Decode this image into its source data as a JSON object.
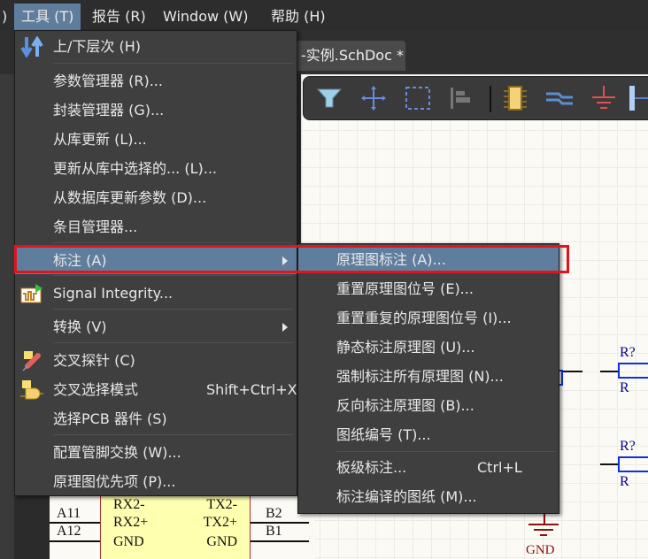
{
  "menubar": {
    "items": [
      {
        "label": ")"
      },
      {
        "label": "工具 (T)"
      },
      {
        "label": "报告 (R)"
      },
      {
        "label": "Window (W)"
      },
      {
        "label": "帮助 (H)"
      }
    ]
  },
  "document_tab": {
    "label": "-实例.SchDoc *"
  },
  "toolbar": {
    "icons": [
      "filter-icon",
      "move-icon",
      "select-rect-icon",
      "align-icon",
      "component-icon",
      "bus-icon",
      "ground-icon",
      "port-icon"
    ]
  },
  "tools_menu": {
    "items": [
      {
        "label": "上/下层次 (H)",
        "icon": "up-down-hierarchy-icon"
      },
      {
        "label": "参数管理器 (R)..."
      },
      {
        "label": "封装管理器 (G)..."
      },
      {
        "label": "从库更新 (L)..."
      },
      {
        "label": "更新从库中选择的... (L)..."
      },
      {
        "label": "从数据库更新参数 (D)..."
      },
      {
        "label": "条目管理器..."
      },
      {
        "label": "标注 (A)",
        "submenu": true,
        "highlighted": true
      },
      {
        "label": "Signal Integrity...",
        "icon": "signal-integrity-icon"
      },
      {
        "label": "转换 (V)",
        "submenu": true
      },
      {
        "label": "交叉探针 (C)",
        "icon": "cross-probe-icon"
      },
      {
        "label": "交叉选择模式",
        "shortcut": "Shift+Ctrl+X",
        "icon": "cross-select-icon"
      },
      {
        "label": "选择PCB 器件 (S)"
      },
      {
        "label": "配置管脚交换 (W)..."
      },
      {
        "label": "原理图优先项 (P)..."
      }
    ]
  },
  "annotate_submenu": {
    "items": [
      {
        "label": "原理图标注 (A)...",
        "highlighted": true
      },
      {
        "label": "重置原理图位号 (E)..."
      },
      {
        "label": "重置重复的原理图位号 (I)..."
      },
      {
        "label": "静态标注原理图 (U)..."
      },
      {
        "label": "强制标注所有原理图 (N)..."
      },
      {
        "label": "反向标注原理图 (B)..."
      },
      {
        "label": "图纸编号 (T)..."
      },
      {
        "label": "板级标注...",
        "shortcut": "Ctrl+L"
      },
      {
        "label": "标注编译的图纸 (M)..."
      }
    ]
  },
  "schematic": {
    "left_pins": [
      "A11",
      "A12"
    ],
    "component_left": [
      "RX2-",
      "RX2+",
      "GND"
    ],
    "component_right": [
      "TX2-",
      "TX2+",
      "GND"
    ],
    "right_pins": [
      "B2",
      "B1"
    ],
    "resistors": [
      {
        "designator": "R?",
        "value": "R"
      },
      {
        "designator": "R?",
        "value": "R"
      }
    ],
    "ground_label": "GND"
  },
  "colors": {
    "highlight": "#5f7e9e",
    "annotation_box": "#e0141e",
    "menu_bg": "#3f3f3f"
  }
}
